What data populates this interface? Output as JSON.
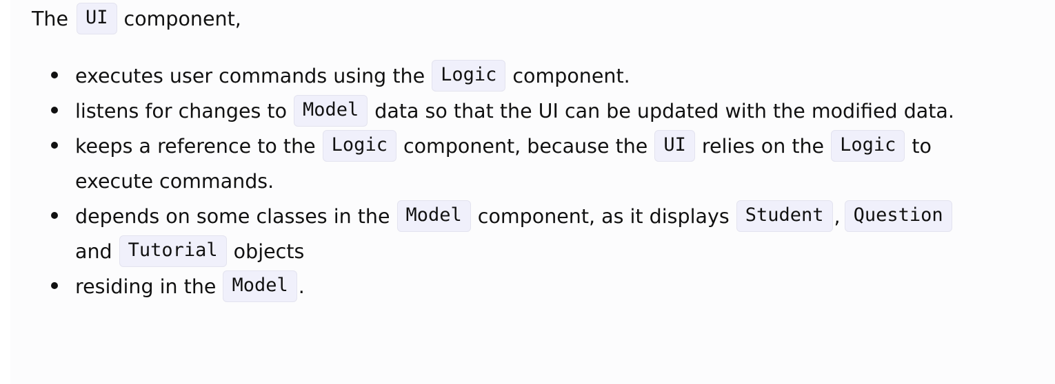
{
  "intro": {
    "before": "The",
    "code": "UI",
    "after": "component,"
  },
  "bullets": [
    {
      "lines": [
        {
          "t1": "executes user commands using the",
          "c1": "Logic",
          "t2": "component."
        }
      ]
    },
    {
      "lines": [
        {
          "t1": "listens for changes to",
          "c1": "Model",
          "t2": "data so that the UI can be updated with the modified data."
        }
      ]
    },
    {
      "lines": [
        {
          "t1": "keeps a reference to the",
          "c1": "Logic",
          "t2": "component, because the",
          "c2": "UI",
          "t3": "relies on the",
          "c3": "Logic",
          "t4": "to"
        },
        {
          "t1": "execute commands."
        }
      ]
    },
    {
      "lines": [
        {
          "t1": "depends on some classes in the",
          "c1": "Model",
          "t2": "component, as it displays",
          "c2": "Student",
          "t3": ",",
          "c3": "Question"
        },
        {
          "t1": "and",
          "c1": "Tutorial",
          "t2": "objects"
        }
      ]
    },
    {
      "lines": [
        {
          "t1": "residing in the",
          "c1": "Model",
          "t2": "."
        }
      ]
    }
  ]
}
